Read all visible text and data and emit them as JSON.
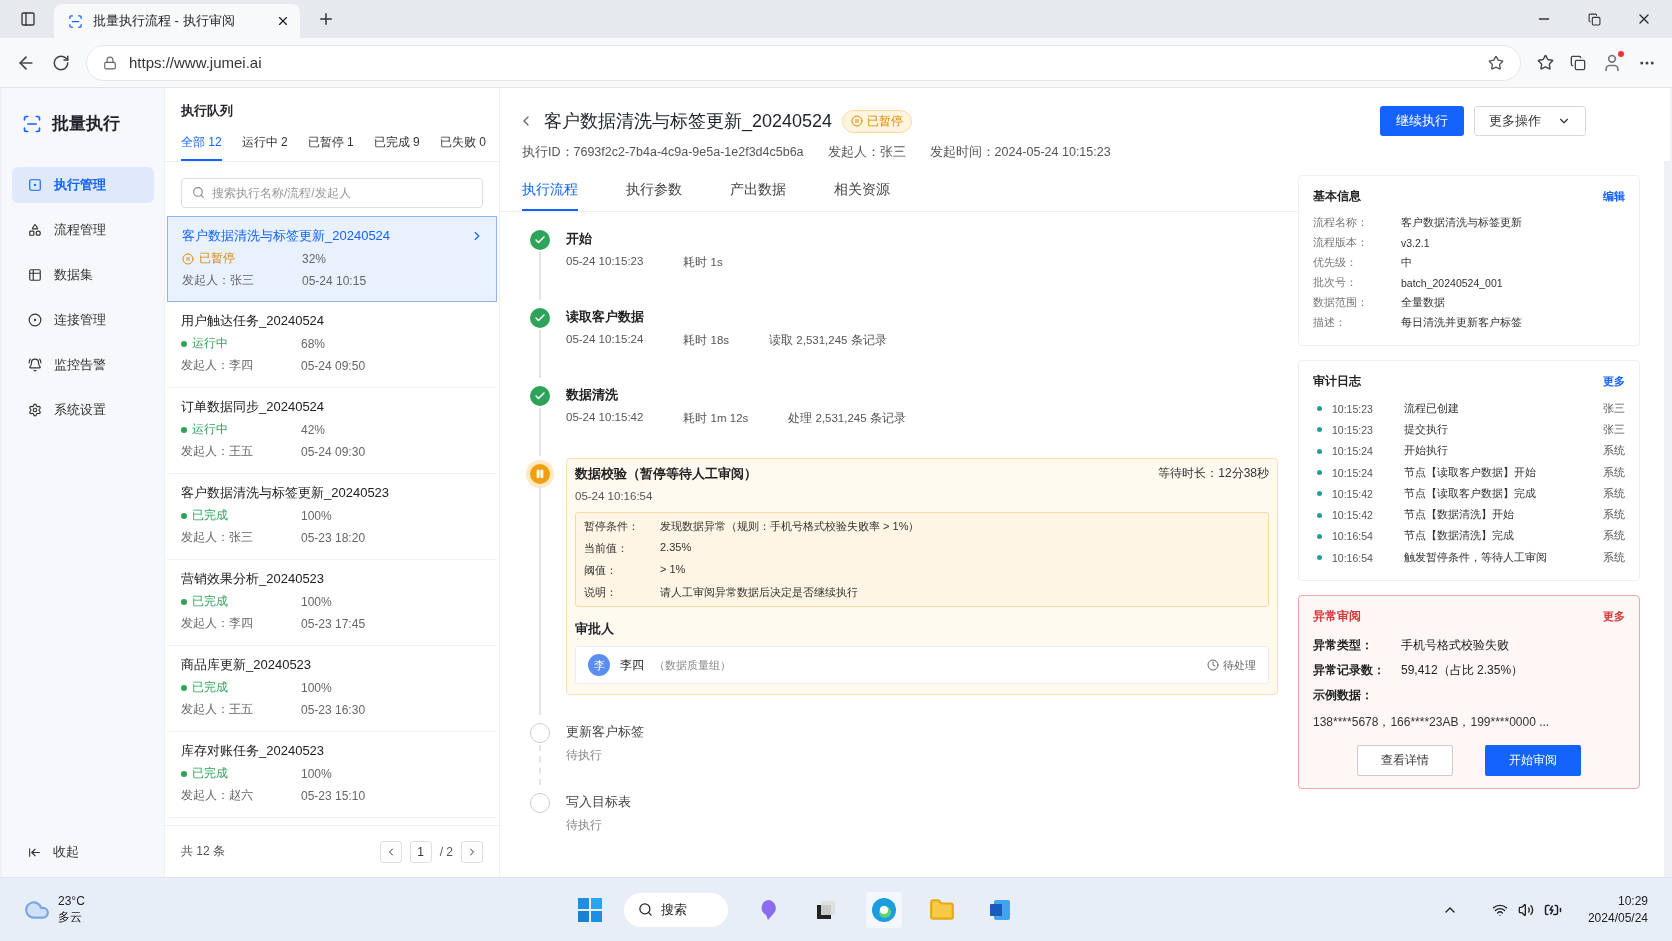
{
  "browser": {
    "tab_title": "批量执行流程 - 执行审阅",
    "url": "https://www.jumei.ai"
  },
  "sidebar": {
    "title": "批量执行",
    "items": [
      {
        "label": "执行管理",
        "selected": true
      },
      {
        "label": "流程管理",
        "selected": false
      },
      {
        "label": "数据集",
        "selected": false
      },
      {
        "label": "连接管理",
        "selected": false
      },
      {
        "label": "监控告警",
        "selected": false
      },
      {
        "label": "系统设置",
        "selected": false
      }
    ],
    "collapse_label": "收起"
  },
  "queue": {
    "title": "执行队列",
    "filters": [
      {
        "label": "全部",
        "count": "12",
        "selected": true
      },
      {
        "label": "运行中",
        "count": "2",
        "selected": false
      },
      {
        "label": "已暂停",
        "count": "1",
        "selected": false
      },
      {
        "label": "已完成",
        "count": "9",
        "selected": false
      },
      {
        "label": "已失败",
        "count": "0",
        "selected": false
      }
    ],
    "search": {
      "placeholder": "搜索执行名称/流程/发起人"
    },
    "items": [
      {
        "name": "客户数据清洗与标签更新_20240524",
        "status": "已暂停",
        "kind": "paused",
        "progress": "32%",
        "initiator": "发起人：张三",
        "time": "05-24 10:15",
        "selected": true
      },
      {
        "name": "用户触达任务_20240524",
        "status": "运行中",
        "kind": "running",
        "progress": "68%",
        "initiator": "发起人：李四",
        "time": "05-24 09:50",
        "selected": false
      },
      {
        "name": "订单数据同步_20240524",
        "status": "运行中",
        "kind": "running",
        "progress": "42%",
        "initiator": "发起人：王五",
        "time": "05-24 09:30",
        "selected": false
      },
      {
        "name": "客户数据清洗与标签更新_20240523",
        "status": "已完成",
        "kind": "done",
        "progress": "100%",
        "initiator": "发起人：张三",
        "time": "05-23 18:20",
        "selected": false
      },
      {
        "name": "营销效果分析_20240523",
        "status": "已完成",
        "kind": "done",
        "progress": "100%",
        "initiator": "发起人：李四",
        "time": "05-23 17:45",
        "selected": false
      },
      {
        "name": "商品库更新_20240523",
        "status": "已完成",
        "kind": "done",
        "progress": "100%",
        "initiator": "发起人：王五",
        "time": "05-23 16:30",
        "selected": false
      },
      {
        "name": "库存对账任务_20240523",
        "status": "已完成",
        "kind": "done",
        "progress": "100%",
        "initiator": "发起人：赵六",
        "time": "05-23 15:10",
        "selected": false
      }
    ],
    "total": "共 12 条",
    "page": "1",
    "pages": "/ 2"
  },
  "detail": {
    "title": "客户数据清洗与标签更新_20240524",
    "status": "已暂停",
    "meta": [
      {
        "label": "执行ID：",
        "value": "7693f2c2-7b4a-4c9a-9e5a-1e2f3d4c5b6a"
      },
      {
        "label": "发起人：",
        "value": "张三"
      },
      {
        "label": "发起时间：",
        "value": "2024-05-24 10:15:23"
      }
    ],
    "primary_button": "继续执行",
    "more_button": "更多操作",
    "tabs": [
      {
        "label": "执行流程",
        "selected": true
      },
      {
        "label": "执行参数",
        "selected": false
      },
      {
        "label": "产出数据",
        "selected": false
      },
      {
        "label": "相关资源",
        "selected": false
      }
    ],
    "steps": [
      {
        "kind": "done",
        "title": "开始",
        "time": "05-24 10:15:23",
        "details": [
          "耗时 1s"
        ]
      },
      {
        "kind": "done",
        "title": "读取客户数据",
        "time": "05-24 10:15:24",
        "details": [
          "耗时 18s",
          "读取 2,531,245 条记录"
        ]
      },
      {
        "kind": "done",
        "title": "数据清洗",
        "time": "05-24 10:15:42",
        "details": [
          "耗时 1m 12s",
          "处理 2,531,245 条记录"
        ]
      },
      {
        "kind": "paused",
        "title": "数据校验（暂停等待人工审阅）",
        "time": "05-24 10:16:54",
        "wait": "等待时长：12分38秒",
        "conditions": [
          {
            "label": "暂停条件：",
            "value": "发现数据异常（规则：手机号格式校验失败率 > 1%）"
          },
          {
            "label": "当前值：",
            "value": "2.35%"
          },
          {
            "label": "阈值：",
            "value": "> 1%"
          },
          {
            "label": "说明：",
            "value": "请人工审阅异常数据后决定是否继续执行"
          }
        ],
        "approver_title": "审批人",
        "approver": {
          "avatar": "李",
          "name": "李四",
          "group": "（数据质量组）",
          "state": "待处理"
        }
      },
      {
        "kind": "pending",
        "title": "更新客户标签",
        "time": "待执行"
      },
      {
        "kind": "pending",
        "title": "写入目标表",
        "time": "待执行"
      }
    ]
  },
  "basic_info": {
    "title": "基本信息",
    "action": "编辑",
    "fields": [
      {
        "label": "流程名称：",
        "value": "客户数据清洗与标签更新"
      },
      {
        "label": "流程版本：",
        "value": "v3.2.1"
      },
      {
        "label": "优先级：",
        "value": "中"
      },
      {
        "label": "批次号：",
        "value": "batch_20240524_001"
      },
      {
        "label": "数据范围：",
        "value": "全量数据"
      },
      {
        "label": "描述：",
        "value": "每日清洗并更新客户标签"
      }
    ]
  },
  "audit_log": {
    "title": "审计日志",
    "action": "更多",
    "entries": [
      {
        "time": "10:15:23",
        "event": "流程已创建",
        "actor": "张三"
      },
      {
        "time": "10:15:23",
        "event": "提交执行",
        "actor": "张三"
      },
      {
        "time": "10:15:24",
        "event": "开始执行",
        "actor": "系统"
      },
      {
        "time": "10:15:24",
        "event": "节点【读取客户数据】开始",
        "actor": "系统"
      },
      {
        "time": "10:15:42",
        "event": "节点【读取客户数据】完成",
        "actor": "系统"
      },
      {
        "time": "10:15:42",
        "event": "节点【数据清洗】开始",
        "actor": "系统"
      },
      {
        "time": "10:16:54",
        "event": "节点【数据清洗】完成",
        "actor": "系统"
      },
      {
        "time": "10:16:54",
        "event": "触发暂停条件，等待人工审阅",
        "actor": "系统"
      }
    ]
  },
  "anomaly": {
    "title": "异常审阅",
    "action": "更多",
    "fields": [
      {
        "label": "异常类型：",
        "value": "手机号格式校验失败"
      },
      {
        "label": "异常记录数：",
        "value": "59,412（占比 2.35%）"
      }
    ],
    "sample_label": "示例数据：",
    "sample": "138****5678，166****23AB，199****0000 ...",
    "secondary_button": "查看详情",
    "primary_button": "开始审阅"
  },
  "taskbar": {
    "temperature": "23°C",
    "weather": "多云",
    "search": "搜索",
    "time": "10:29",
    "date": "2024/05/24"
  }
}
